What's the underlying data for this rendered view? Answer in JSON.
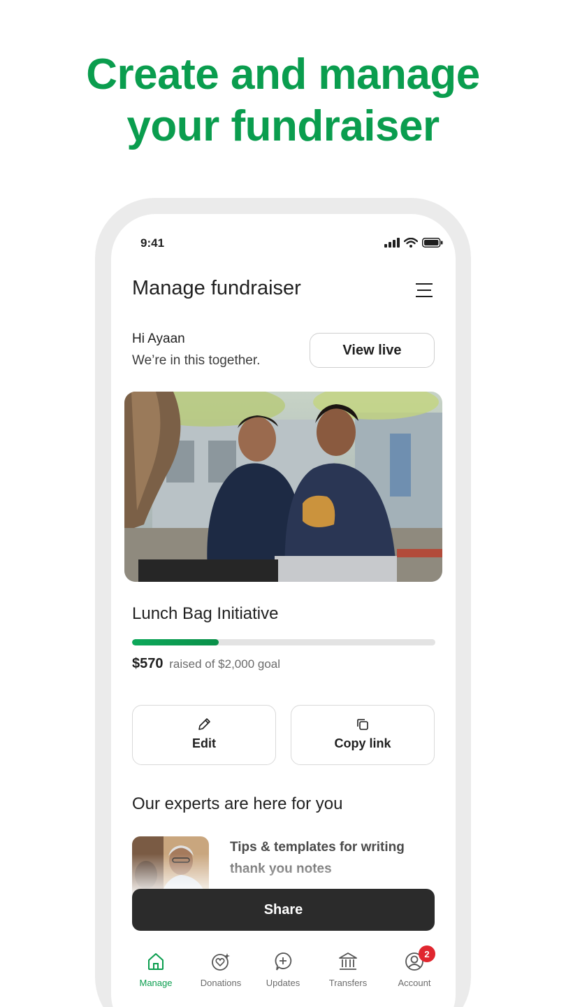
{
  "promo": {
    "headline_line1": "Create and manage",
    "headline_line2": "your fundraiser"
  },
  "status_bar": {
    "time": "9:41",
    "icons": [
      "signal-icon",
      "wifi-icon",
      "battery-icon"
    ]
  },
  "header": {
    "title": "Manage fundraiser",
    "menu_icon": "hamburger-menu-icon"
  },
  "greeting": {
    "name_line": "Hi Ayaan",
    "subtitle": "We’re in this together.",
    "view_live_label": "View live"
  },
  "fundraiser": {
    "title": "Lunch Bag Initiative",
    "raised_amount": "$570",
    "raised_text": "raised of $2,000 goal",
    "progress_fraction": 0.285
  },
  "actions": {
    "edit_label": "Edit",
    "copy_link_label": "Copy link"
  },
  "experts": {
    "title": "Our experts are here for you",
    "card_title_line1": "Tips & templates for writing",
    "card_title_line2": "thank you notes"
  },
  "share_label": "Share",
  "nav": {
    "items": [
      {
        "label": "Manage",
        "icon": "home-icon",
        "active": true
      },
      {
        "label": "Donations",
        "icon": "heart-sparkle-icon",
        "active": false
      },
      {
        "label": "Updates",
        "icon": "update-plus-icon",
        "active": false
      },
      {
        "label": "Transfers",
        "icon": "bank-icon",
        "active": false
      },
      {
        "label": "Account",
        "icon": "account-icon",
        "active": false
      }
    ],
    "account_badge": "2"
  },
  "colors": {
    "brand_green": "#0a9d4e",
    "share_bg": "#2b2b2b",
    "badge_red": "#e0262f"
  }
}
